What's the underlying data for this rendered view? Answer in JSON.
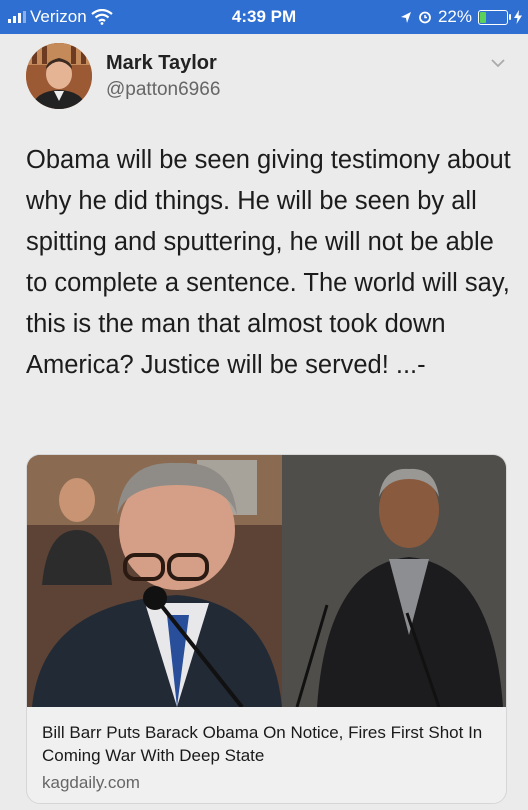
{
  "status_bar": {
    "carrier": "Verizon",
    "time": "4:39 PM",
    "battery_percent": "22%",
    "battery_level": 0.22,
    "icons": [
      "signal-icon",
      "wifi-icon",
      "location-icon",
      "alarm-icon",
      "battery-icon",
      "charging-icon"
    ],
    "bg_color": "#2f6fd1"
  },
  "tweet": {
    "author_name": "Mark Taylor",
    "author_handle": "@patton6966",
    "text": "Obama will be seen giving testimony about why he did things. He will be seen by all  spitting and sputtering, he will not be able to complete a sentence. The world will say, this is the man that almost took down America? Justice will be served! ...-"
  },
  "card": {
    "title": "Bill Barr Puts Barack Obama On Notice, Fires First Shot In Coming War With Deep State",
    "domain": "kagdaily.com"
  }
}
